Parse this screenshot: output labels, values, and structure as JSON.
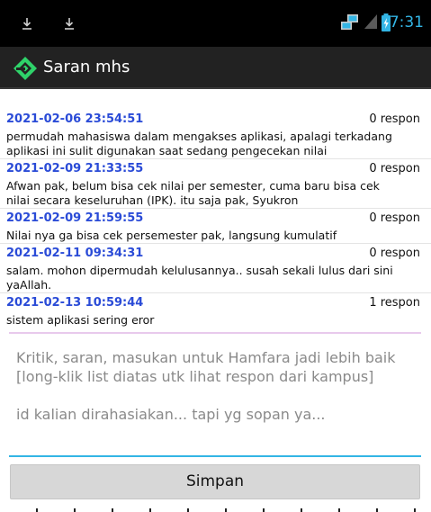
{
  "status_bar": {
    "time": "7:31",
    "colors": {
      "clock": "#33b5e5",
      "background": "#000000"
    },
    "icons": [
      "download-icon",
      "download-icon",
      "network-icon",
      "signal-icon",
      "battery-charging-icon"
    ]
  },
  "action_bar": {
    "title": "Saran mhs",
    "logo_icon": "hamfara-logo-icon",
    "colors": {
      "background": "#222222",
      "logo": "#2fd26a"
    }
  },
  "list": {
    "items": [
      {
        "date": "2021-02-06 23:54:51",
        "count": "0 respon",
        "message": "permudah mahasiswa dalam mengakses aplikasi, apalagi terkadang aplikasi ini sulit digunakan saat sedang pengecekan nilai"
      },
      {
        "date": "2021-02-09 21:33:55",
        "count": "0 respon",
        "message": "Afwan pak, belum bisa cek nilai per semester, cuma baru bisa cek nilai secara keseluruhan (IPK). itu saja pak, Syukron"
      },
      {
        "date": "2021-02-09 21:59:55",
        "count": "0 respon",
        "message": "Nilai nya ga bisa cek persemester pak, langsung kumulatif"
      },
      {
        "date": "2021-02-11 09:34:31",
        "count": "0 respon",
        "message": "salam. mohon dipermudah kelulusannya.. susah sekali lulus dari sini yaAllah."
      },
      {
        "date": "2021-02-13 10:59:44",
        "count": "1 respon",
        "message": "sistem aplikasi sering eror"
      }
    ],
    "colors": {
      "date": "#2a4bd7"
    }
  },
  "input": {
    "placeholder": "Kritik, saran, masukan untuk Hamfara jadi lebih baik\n[long-klik list diatas utk lihat respon dari kampus]\n\nid kalian dirahasiakan... tapi yg sopan ya...",
    "value": "",
    "colors": {
      "focus_line": "#33b5e5"
    }
  },
  "save_button": {
    "label": "Simpan"
  }
}
